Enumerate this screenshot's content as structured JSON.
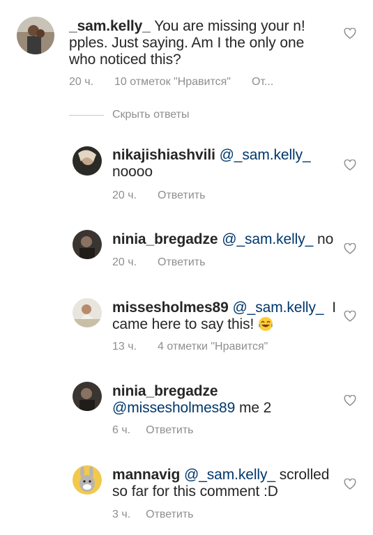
{
  "hide_replies_label": "Скрыть ответы",
  "reply_label": "Ответить",
  "main_comment": {
    "username": "_sam.kelly_",
    "text_line1": "You are missing your n!",
    "text_line2": "pples. Just saying. Am I the only one",
    "text_line3": "who noticed this?",
    "time": "20 ч.",
    "likes": "10 отметок \"Нравится\"",
    "reply_truncated": "От..."
  },
  "replies": [
    {
      "username": "nikajishiashvili",
      "mention": "@_sam.kelly_",
      "text": "noooo",
      "time": "20 ч."
    },
    {
      "username": "ninia_bregadze",
      "mention": "@_sam.kelly_",
      "text": "no",
      "time": "20 ч."
    },
    {
      "username": "missesholmes89",
      "mention": "@_sam.kelly_",
      "text_line1_tail": "I",
      "text_line2": "came here to say this!",
      "emoji": "face-with-tears-of-joy-icon",
      "time": "13 ч.",
      "likes": "4 отметки \"Нравится\""
    },
    {
      "username": "ninia_bregadze",
      "mention": "@missesholmes89",
      "text": "me 2",
      "time": "6 ч."
    },
    {
      "username": "mannavig",
      "mention": "@_sam.kelly_",
      "text_line1_tail": "scrolled",
      "text_line2": "so far for this comment :D",
      "time": "3 ч."
    }
  ],
  "colors": {
    "text": "#262626",
    "meta": "#8e8e8e",
    "mention": "#00376b"
  }
}
